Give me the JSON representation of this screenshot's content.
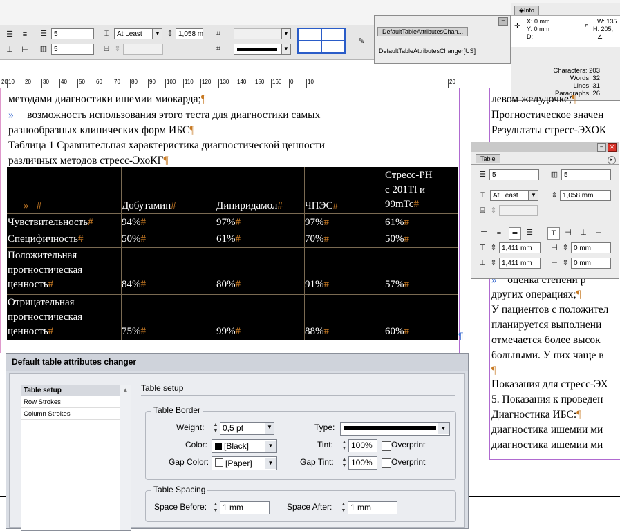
{
  "control_panel": {
    "rows_value": "5",
    "columns_value": "5",
    "row_height_mode": "At Least",
    "row_height_value": "1,058 m"
  },
  "script_panel": {
    "tab": "DefaultTableAttributesChan...",
    "item": "DefaultTableAttributesChanger[US]"
  },
  "info_panel": {
    "tab": "Info",
    "x": "X: 0 mm",
    "y": "Y: 0 mm",
    "d": "D:",
    "w": "W: 135",
    "h": "H: 205,",
    "characters": "Characters: 203",
    "words": "Words: 32",
    "lines": "Lines: 31",
    "paragraphs": "Paragraphs: 26"
  },
  "ruler": {
    "labels": [
      "20",
      "10",
      "20",
      "30",
      "40",
      "50",
      "60",
      "70",
      "80",
      "90",
      "100",
      "110",
      "120",
      "130",
      "140",
      "150",
      "160",
      "0",
      "10",
      "20"
    ]
  },
  "document": {
    "line1": "методами диагностики ишемии миокарда;",
    "line2": "возможность использования этого теста для диагностики самых",
    "line3": "разнообразных клинических форм ИБС",
    "line4": "Таблица 1 Сравнительная характеристика диагностической ценности",
    "line5": "различных методов стресс-ЭхоКГ",
    "table": {
      "headers": [
        "Добутамин",
        "Дипиридамол",
        "ЧПЭС"
      ],
      "header_last": [
        "Стресс-РН",
        "с 201Tl и",
        "99mTc"
      ],
      "rows": [
        {
          "label": [
            "Чувствительность"
          ],
          "values": [
            "94%",
            "97%",
            "97%",
            "61%"
          ]
        },
        {
          "label": [
            "Специфичность"
          ],
          "values": [
            "50%",
            "61%",
            "70%",
            "50%"
          ]
        },
        {
          "label": [
            "Положительная",
            "прогностическая",
            "ценность"
          ],
          "values": [
            "84%",
            "80%",
            "91%",
            "57%"
          ]
        },
        {
          "label": [
            "Отрицательная",
            "прогностическая",
            "ценность"
          ],
          "values": [
            "75%",
            "99%",
            "88%",
            "60%"
          ]
        }
      ]
    },
    "right_lines": [
      "левом желудочке;",
      "Прогностическое значен",
      "Результаты стресс-ЭХОК",
      "оценка степени р",
      "других операциях;",
      "У пациентов с положител",
      "планируется выполнени",
      "отмечается более высок",
      "больными. У них чаще в",
      "Показания для стресс-ЭХ",
      "5. Показания к проведен",
      "Диагностика ИБС:",
      "диагностика ишемии ми",
      "диагностика ишемии ми"
    ]
  },
  "table_panel": {
    "tab": "Table",
    "rows": "5",
    "cols": "5",
    "height_mode": "At Least",
    "height_value": "1,058 mm",
    "inset_top": "1,411 mm",
    "inset_bottom": "1,411 mm",
    "inset_left": "0 mm",
    "inset_right": "0 mm"
  },
  "dialog": {
    "title": "Default table attributes changer",
    "nav_items": [
      "Table setup",
      "Row Strokes",
      "Column Strokes"
    ],
    "section_title": "Table setup",
    "border_group": "Table Border",
    "weight_label": "Weight:",
    "weight_value": "0,5 pt",
    "type_label": "Type:",
    "color_label": "Color:",
    "color_value": "[Black]",
    "tint_label": "Tint:",
    "tint_value": "100%",
    "overprint_label": "Overprint",
    "gap_color_label": "Gap Color:",
    "gap_color_value": "[Paper]",
    "gap_tint_label": "Gap Tint:",
    "gap_tint_value": "100%",
    "overprint2_label": "Overprint",
    "spacing_group": "Table Spacing",
    "space_before_label": "Space Before:",
    "space_before_value": "1 mm",
    "space_after_label": "Space After:",
    "space_after_value": "1 mm"
  }
}
